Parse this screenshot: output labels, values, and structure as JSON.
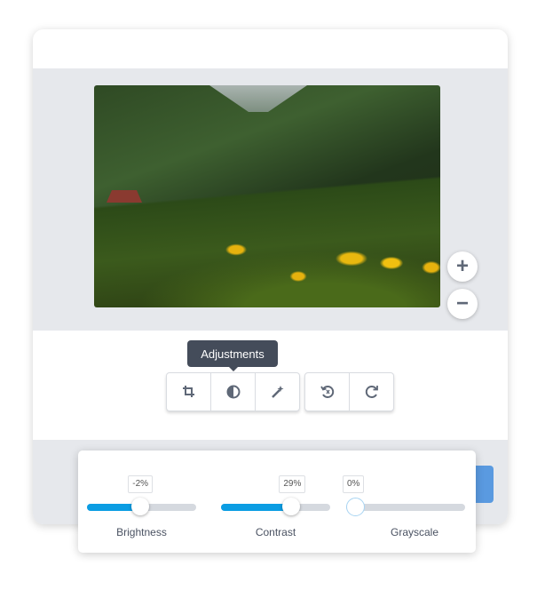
{
  "stage": {
    "zoom_in_label": "+",
    "zoom_out_label": "−"
  },
  "toolbar": {
    "tooltip": "Adjustments",
    "tools": [
      {
        "icon": "crop-icon"
      },
      {
        "icon": "contrast-icon"
      },
      {
        "icon": "magic-wand-icon"
      }
    ],
    "history": [
      {
        "icon": "reset-icon"
      },
      {
        "icon": "redo-icon"
      }
    ]
  },
  "adjustments": [
    {
      "label": "Brightness",
      "value_label": "-2%",
      "value": -2,
      "min": -100,
      "max": 100
    },
    {
      "label": "Contrast",
      "value_label": "29%",
      "value": 29,
      "min": -100,
      "max": 100
    },
    {
      "label": "Grayscale",
      "value_label": "0%",
      "value": 0,
      "min": 0,
      "max": 100
    }
  ],
  "colors": {
    "accent": "#0b9de3",
    "tooltip_bg": "#444c5a",
    "apply_button": "#5a9ae0"
  }
}
